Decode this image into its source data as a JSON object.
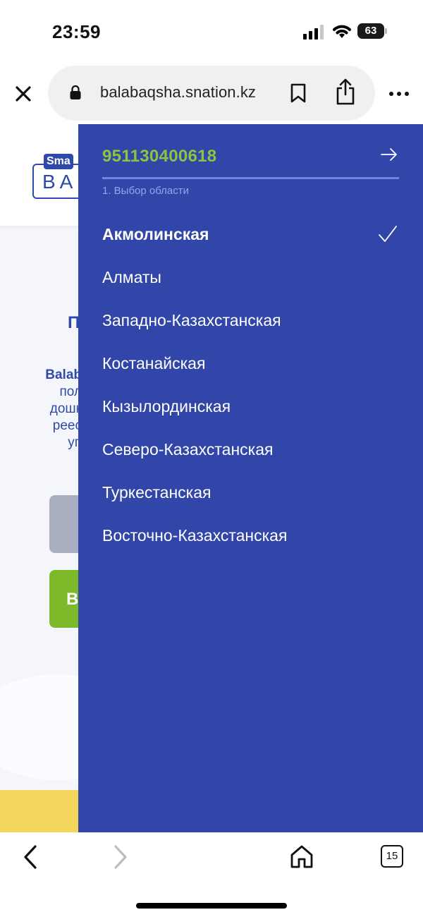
{
  "status_bar": {
    "time": "23:59",
    "battery_level": "63",
    "icons": [
      "cellular-signal-icon",
      "wifi-icon",
      "battery-icon"
    ]
  },
  "browser": {
    "url": "balabaqsha.snation.kz",
    "icons": [
      "close-icon",
      "lock-icon",
      "bookmark-icon",
      "share-icon",
      "more-icon"
    ]
  },
  "background_page": {
    "logo_top": "Sma",
    "logo_text": "BA",
    "heading_fragment": "П",
    "text_lines": [
      "Balab",
      "пол",
      "дошк",
      "реес",
      "уп"
    ],
    "green_button_fragment": "В"
  },
  "drawer": {
    "user_id": "951130400618",
    "step_label": "1. Выбор области",
    "regions": [
      {
        "label": "Акмолинская",
        "selected": true
      },
      {
        "label": "Алматы",
        "selected": false
      },
      {
        "label": "Западно-Казахстанская",
        "selected": false
      },
      {
        "label": "Костанайская",
        "selected": false
      },
      {
        "label": "Кызылординская",
        "selected": false
      },
      {
        "label": "Северо-Казахстанская",
        "selected": false
      },
      {
        "label": "Туркестанская",
        "selected": false
      },
      {
        "label": "Восточно-Казахстанская",
        "selected": false
      }
    ],
    "colors": {
      "background": "#3146a8",
      "accent": "#8bc53f"
    }
  },
  "bottom_toolbar": {
    "tab_count": "15",
    "icons": [
      "back-icon",
      "forward-icon",
      "home-icon",
      "tabs-icon"
    ]
  }
}
